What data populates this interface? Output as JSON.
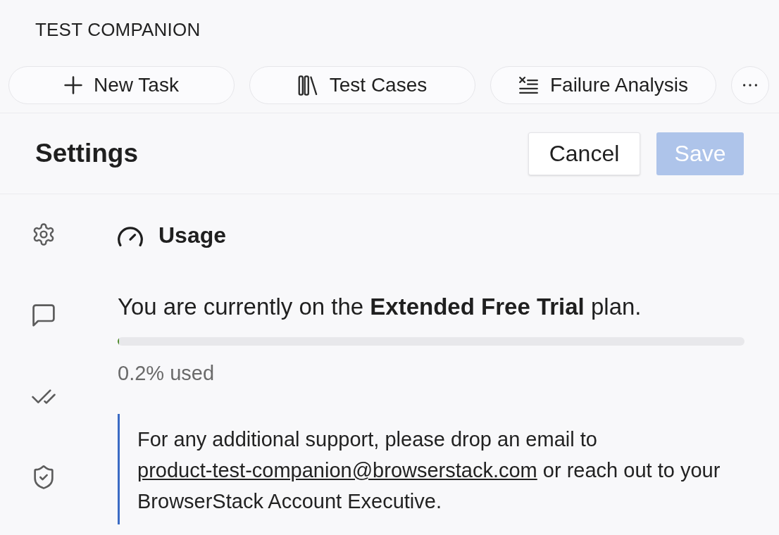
{
  "app_title": "TEST COMPANION",
  "actions": [
    {
      "label": "New Task"
    },
    {
      "label": "Test Cases"
    },
    {
      "label": "Failure Analysis"
    }
  ],
  "settings": {
    "title": "Settings",
    "buttons": [
      {
        "label": "Cancel",
        "kind": "secondary",
        "disabled": false
      },
      {
        "label": "Save",
        "kind": "primary",
        "disabled": true
      }
    ]
  },
  "usage": {
    "title": "Usage",
    "plan_text": "You are currently on the **Extended Free Trial** plan.",
    "level": 0.002,
    "reading": "0.2% used"
  },
  "support": {
    "text_before": "For any additional support, please drop an email to",
    "link": "product-test-companion@browserstack.com",
    "text_after": "or reach out to your BrowserStack Account Executive."
  }
}
